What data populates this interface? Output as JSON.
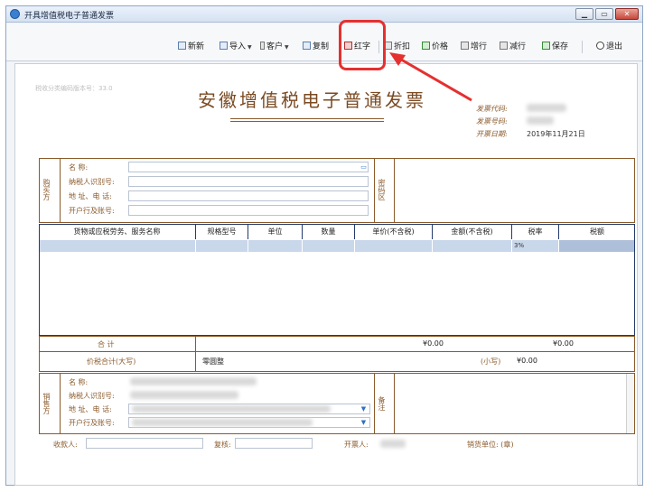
{
  "window": {
    "title": "开具增值税电子普通发票"
  },
  "toolbar": {
    "new_label": "新新",
    "import_label": "导入",
    "customer_label": "客户",
    "copy_label": "复制",
    "red_label": "红字",
    "discount_label": "折扣",
    "price_label": "价格",
    "add_row_label": "增行",
    "del_row_label": "减行",
    "save_label": "保存",
    "exit_label": "退出"
  },
  "doc": {
    "faint_text": "税收分类编码版本号：33.0",
    "title": "安徽增值税电子普通发票",
    "invoice_code_label": "发票代码:",
    "invoice_no_label": "发票号码:",
    "date_label": "开票日期:",
    "date_value": "2019年11月21日"
  },
  "buyer": {
    "side_label": "购买方",
    "name_label": "名            称:",
    "tax_id_label": "纳税人识别号:",
    "addr_label": "地  址、电  话:",
    "bank_label": "开户行及账号:",
    "code_area_label": "密码区"
  },
  "table": {
    "headers": [
      "货物或应税劳务、服务名称",
      "规格型号",
      "单位",
      "数量",
      "单价(不含税)",
      "金额(不含税)",
      "税率",
      "税额"
    ],
    "row": {
      "rate": "3%"
    }
  },
  "totals": {
    "total_label": "合          计",
    "amount": "¥0.00",
    "tax": "¥0.00",
    "sum_label": "价税合计(大写)",
    "sum_words": "零圆整",
    "small_label": "(小写)",
    "small_value": "¥0.00"
  },
  "seller": {
    "side_label": "销售方",
    "name_label": "名            称:",
    "tax_id_label": "纳税人识别号:",
    "addr_label": "地  址、电  话:",
    "bank_label": "开户行及账号:",
    "remark_label": "备注"
  },
  "footer": {
    "payee_label": "收款人:",
    "review_label": "复核:",
    "drawer_label": "开票人:",
    "seller_seal_label": "销货单位:  (章)"
  },
  "colors": {
    "accent_red": "#e53030",
    "invoice_brown": "#8b5a2b",
    "row_blue": "#c9d7eb"
  }
}
